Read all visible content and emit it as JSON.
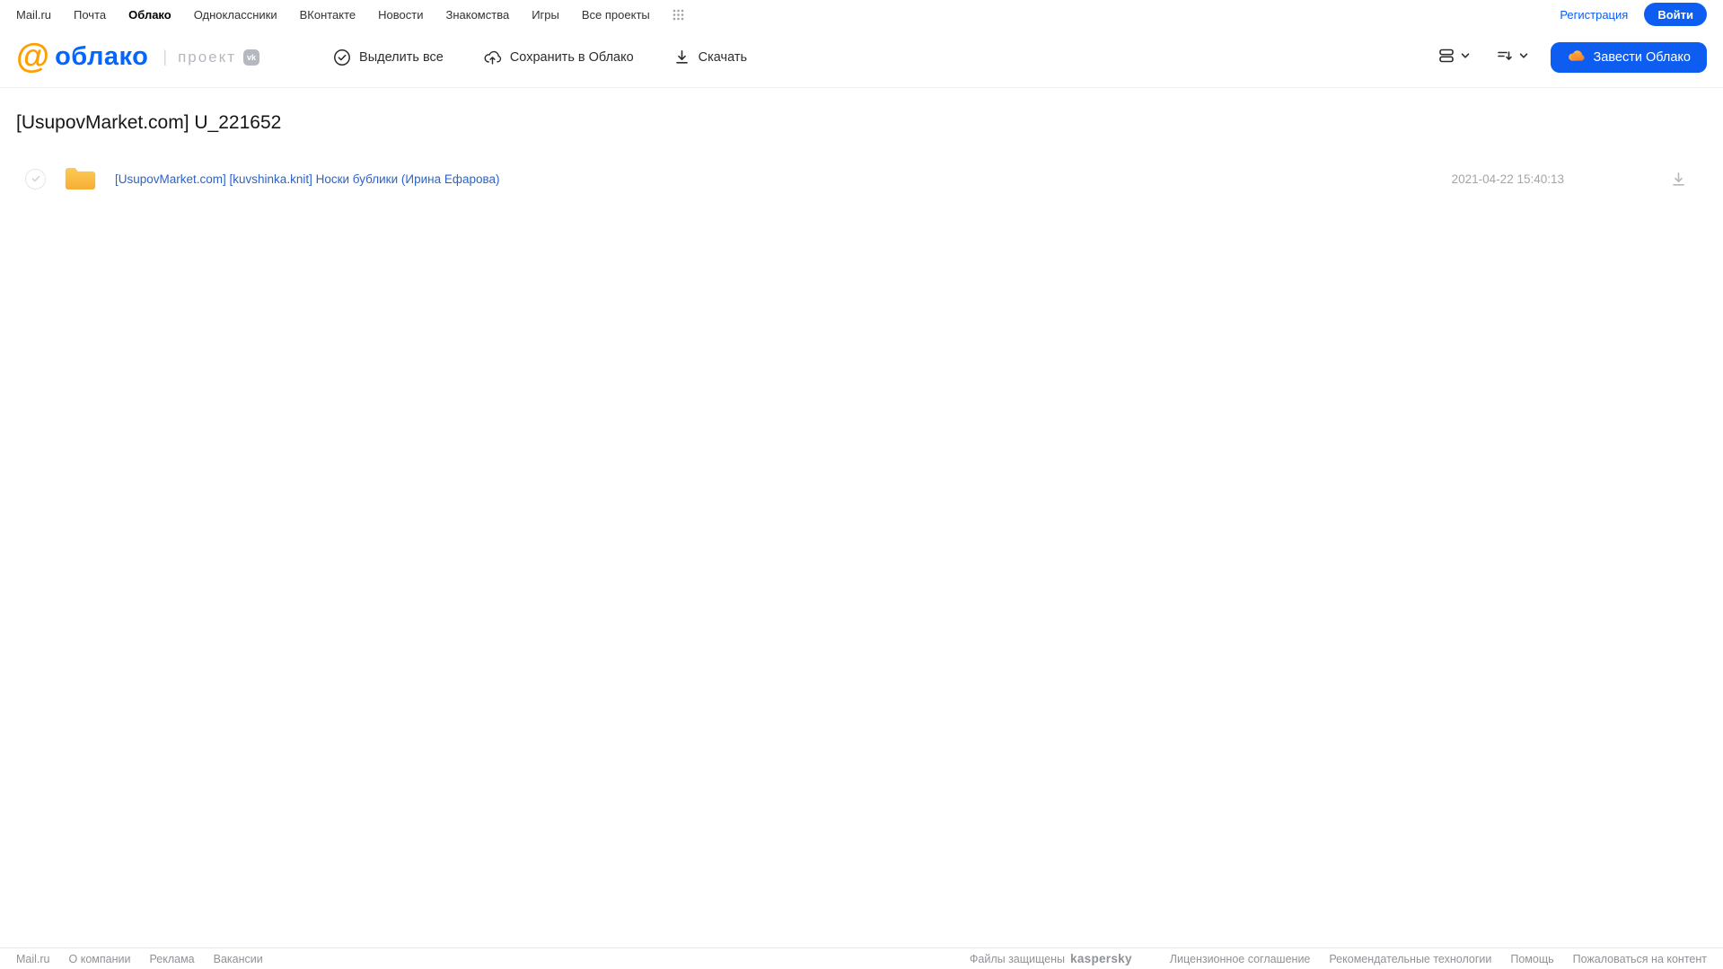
{
  "colors": {
    "brand_blue": "#0d5ef0",
    "logo_orange": "#ff9e00",
    "logo_blue": "#0566ff",
    "file_link_blue": "#2d63c8",
    "kaspersky_green": "#00a88e",
    "folder_amber": "#f9bb45"
  },
  "topnav": {
    "items": [
      "Mail.ru",
      "Почта",
      "Облако",
      "Одноклассники",
      "ВКонтакте",
      "Новости",
      "Знакомства",
      "Игры",
      "Все проекты"
    ],
    "register_label": "Регистрация",
    "login_label": "Войти"
  },
  "header": {
    "logo_at": "@",
    "logo_text": "облако",
    "divider": "|",
    "project_label": "проект",
    "vk_badge_label": "vk",
    "toolbar": {
      "select_all_label": "Выделить все",
      "save_label": "Сохранить в Облако",
      "download_label": "Скачать"
    },
    "get_cloud_label": "Завести Облако"
  },
  "main": {
    "title": "[UsupovMarket.com] U_221652",
    "files": [
      {
        "name": "[UsupovMarket.com] [kuvshinka.knit] Носки бублики (Ирина Ефарова)",
        "modified": "2021-04-22 15:40:13"
      }
    ]
  },
  "footer": {
    "left_links": [
      "Mail.ru",
      "О компании",
      "Реклама",
      "Вакансии"
    ],
    "protected_label": "Файлы защищены",
    "kaspersky_label": "kaspersky",
    "right_links": [
      "Лицензионное соглашение",
      "Рекомендательные технологии",
      "Помощь",
      "Пожаловаться на контент"
    ]
  }
}
